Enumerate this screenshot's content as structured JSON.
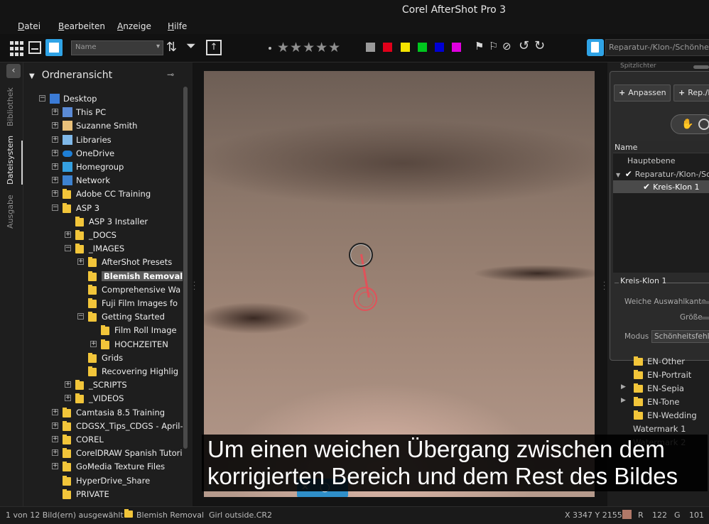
{
  "window": {
    "title": "Corel AfterShot Pro 3"
  },
  "menu": [
    "Datei",
    "Bearbeiten",
    "Anzeige",
    "Hilfe"
  ],
  "toolbar": {
    "sort_placeholder": "Name",
    "stars": "★★★★★",
    "color_labels": [
      "#9a9a9a",
      "#e0001a",
      "#f4e300",
      "#00c61e",
      "#0000d4",
      "#e000e0"
    ],
    "preset_name": "Reparatur-/Klon-/Schönheitsfehler"
  },
  "sidebar_tabs": [
    "Bibliothek",
    "Dateisystem",
    "Ausgabe"
  ],
  "folder_panel": {
    "title": "Ordneransicht",
    "tree": [
      {
        "label": "Desktop",
        "depth": 0,
        "exp": "-",
        "icon": "desktop"
      },
      {
        "label": "This PC",
        "depth": 1,
        "exp": "+",
        "icon": "pc"
      },
      {
        "label": "Suzanne Smith",
        "depth": 1,
        "exp": "+",
        "icon": "user"
      },
      {
        "label": "Libraries",
        "depth": 1,
        "exp": "+",
        "icon": "libraries"
      },
      {
        "label": "OneDrive",
        "depth": 1,
        "exp": "+",
        "icon": "cloud"
      },
      {
        "label": "Homegroup",
        "depth": 1,
        "exp": "+",
        "icon": "homegroup"
      },
      {
        "label": "Network",
        "depth": 1,
        "exp": "+",
        "icon": "network"
      },
      {
        "label": "Adobe CC Training",
        "depth": 1,
        "exp": "+",
        "icon": "folder"
      },
      {
        "label": "ASP 3",
        "depth": 1,
        "exp": "-",
        "icon": "folder"
      },
      {
        "label": "ASP 3 Installer",
        "depth": 2,
        "exp": "",
        "icon": "folder"
      },
      {
        "label": "_DOCS",
        "depth": 2,
        "exp": "+",
        "icon": "folder"
      },
      {
        "label": "_IMAGES",
        "depth": 2,
        "exp": "-",
        "icon": "folder"
      },
      {
        "label": "AfterShot Presets",
        "depth": 3,
        "exp": "+",
        "icon": "folder"
      },
      {
        "label": "Blemish Removal",
        "depth": 3,
        "exp": "",
        "icon": "folder",
        "selected": true
      },
      {
        "label": "Comprehensive Wa",
        "depth": 3,
        "exp": "",
        "icon": "folder"
      },
      {
        "label": "Fuji Film Images fo",
        "depth": 3,
        "exp": "",
        "icon": "folder"
      },
      {
        "label": "Getting Started",
        "depth": 3,
        "exp": "-",
        "icon": "folder"
      },
      {
        "label": "Film Roll Image",
        "depth": 4,
        "exp": "",
        "icon": "folder"
      },
      {
        "label": "HOCHZEITEN",
        "depth": 4,
        "exp": "+",
        "icon": "folder"
      },
      {
        "label": "Grids",
        "depth": 3,
        "exp": "",
        "icon": "folder"
      },
      {
        "label": "Recovering Highlig",
        "depth": 3,
        "exp": "",
        "icon": "folder"
      },
      {
        "label": "_SCRIPTS",
        "depth": 2,
        "exp": "+",
        "icon": "folder"
      },
      {
        "label": "_VIDEOS",
        "depth": 2,
        "exp": "+",
        "icon": "folder"
      },
      {
        "label": "Camtasia 8.5 Training",
        "depth": 1,
        "exp": "+",
        "icon": "folder"
      },
      {
        "label": "CDGSX_Tips_CDGS - April-",
        "depth": 1,
        "exp": "+",
        "icon": "folder"
      },
      {
        "label": "COREL",
        "depth": 1,
        "exp": "+",
        "icon": "folder"
      },
      {
        "label": "CorelDRAW Spanish Tutori",
        "depth": 1,
        "exp": "+",
        "icon": "folder"
      },
      {
        "label": "GoMedia Texture Files",
        "depth": 1,
        "exp": "+",
        "icon": "folder"
      },
      {
        "label": "HyperDrive_Share",
        "depth": 1,
        "exp": "",
        "icon": "folder"
      },
      {
        "label": "PRIVATE",
        "depth": 1,
        "exp": "",
        "icon": "folder"
      }
    ]
  },
  "right_panel": {
    "top_label": "Spitzlichter",
    "buttons": [
      {
        "icon": "+",
        "label": "Anpassen"
      },
      {
        "icon": "+",
        "label": "Rep./K"
      }
    ],
    "layers_header": "Name",
    "layers": [
      {
        "label": "Hauptebene",
        "checked": false,
        "indent": 0
      },
      {
        "label": "Reparatur-/Klon-/Sc",
        "checked": true,
        "indent": 1
      },
      {
        "label": "Kreis-Klon 1",
        "checked": true,
        "indent": 2,
        "selected": true
      }
    ],
    "properties_title": "Kreis-Klon 1",
    "feather_label": "Weiche Auswahlkante",
    "size_label": "Größe",
    "mode_label": "Modus",
    "mode_value": "Schönheitsfehler"
  },
  "preset_list": [
    {
      "label": "EN-Other",
      "tri": false
    },
    {
      "label": "EN-Portrait",
      "tri": false
    },
    {
      "label": "EN-Sepia",
      "tri": true
    },
    {
      "label": "EN-Tone",
      "tri": true
    },
    {
      "label": "EN-Wedding",
      "tri": false
    },
    {
      "label": "Watermark 1",
      "tri": false,
      "plain": true
    },
    {
      "label": "Watermark 2",
      "tri": false,
      "plain": true
    }
  ],
  "subtitle": [
    "Um einen weichen Übergang zwischen dem",
    "korrigierten Bereich und dem Rest des Bildes"
  ],
  "status": {
    "selection": "1 von 12 Bild(ern) ausgewählt",
    "folder": "Blemish Removal",
    "file": "Girl outside.CR2",
    "coords": "X 3347  Y 2155",
    "pixel_color": "#b07868",
    "r_label": "R",
    "r_value": "122",
    "g_label": "G",
    "g_value": "101"
  }
}
